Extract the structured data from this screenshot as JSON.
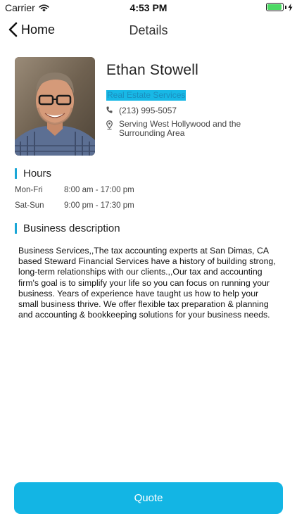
{
  "status_bar": {
    "carrier": "Carrier",
    "time": "4:53 PM",
    "battery_level": 0.95,
    "signal_icon": "wifi-icon",
    "charging_icon": "bolt-icon"
  },
  "nav": {
    "back_label": "Home",
    "back_icon": "chevron-left-icon",
    "title": "Details"
  },
  "profile": {
    "name": "Ethan Stowell",
    "category": "Real Estate Services",
    "phone": "(213) 995-5057",
    "service_area": "Serving West Hollywood and the Surrounding Area",
    "phone_icon": "phone-icon",
    "location_icon": "map-pin-icon"
  },
  "hours": {
    "title": "Hours",
    "rows": [
      {
        "days": "Mon-Fri",
        "time": "8:00 am - 17:00 pm"
      },
      {
        "days": "Sat-Sun",
        "time": "9:00 pm - 17:30 pm"
      }
    ]
  },
  "description": {
    "title": "Business description",
    "text": "Business Services,,The tax accounting experts at San Dimas, CA based Steward Financial Services have a history of building strong, long-term relationships with our clients.,,Our tax and accounting firm's goal is to simplify your life so you can focus on running your business. Years of experience have taught us how to help your small business thrive. We offer flexible tax preparation & planning and accounting & bookkeeping solutions for your business needs."
  },
  "actions": {
    "quote_label": "Quote"
  },
  "colors": {
    "accent": "#13b5e4",
    "section_bar": "#1aa6d6",
    "battery": "#4cd964"
  }
}
